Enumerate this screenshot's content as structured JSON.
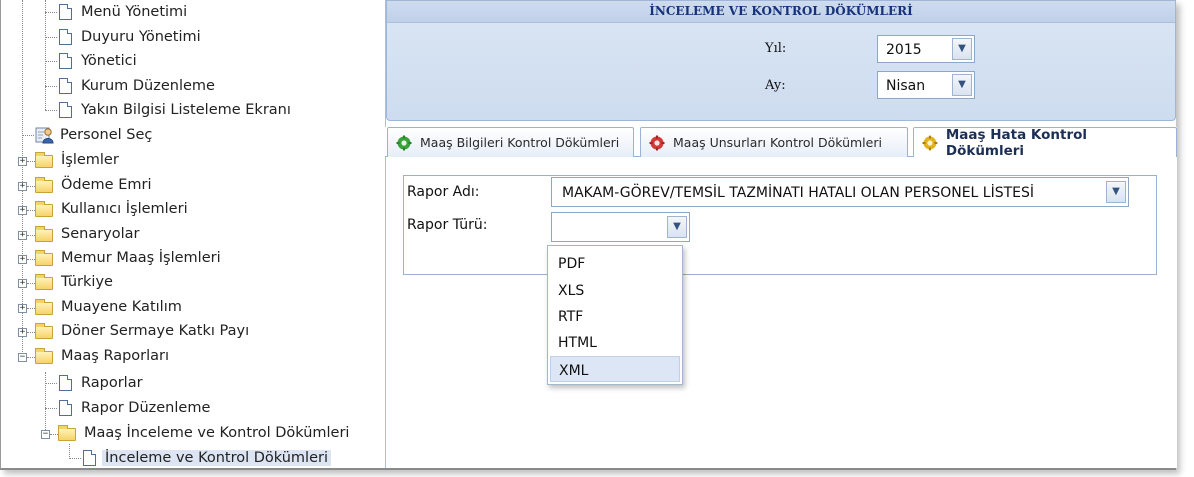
{
  "tree": {
    "items": [
      {
        "label": "Menü Yönetimi",
        "type": "doc"
      },
      {
        "label": "Duyuru Yönetimi",
        "type": "doc"
      },
      {
        "label": "Yönetici",
        "type": "doc"
      },
      {
        "label": "Kurum Düzenleme",
        "type": "doc"
      },
      {
        "label": "Yakın Bilgisi Listeleme Ekranı",
        "type": "doc"
      },
      {
        "label": "Personel Seç",
        "type": "user"
      },
      {
        "label": "İşlemler",
        "type": "folder"
      },
      {
        "label": "Ödeme Emri",
        "type": "folder"
      },
      {
        "label": "Kullanıcı İşlemleri",
        "type": "folder"
      },
      {
        "label": "Senaryolar",
        "type": "folder"
      },
      {
        "label": "Memur Maaş İşlemleri",
        "type": "folder"
      },
      {
        "label": "Türkiye",
        "type": "folder"
      },
      {
        "label": "Muayene Katılım",
        "type": "folder"
      },
      {
        "label": "Döner Sermaye Katkı Payı",
        "type": "folder"
      },
      {
        "label": "Maaş Raporları",
        "type": "folder-open"
      },
      {
        "label": "Raporlar",
        "type": "doc"
      },
      {
        "label": "Rapor Düzenleme",
        "type": "doc"
      },
      {
        "label": "Maaş İnceleme ve Kontrol Dökümleri",
        "type": "folder-open"
      },
      {
        "label": "İnceleme ve Kontrol Dökümleri",
        "type": "doc",
        "selected": true
      }
    ],
    "expand_plus": "+",
    "expand_minus": "−"
  },
  "filter": {
    "title": "İNCELEME VE KONTROL DÖKÜMLERİ",
    "year_label": "Yıl:",
    "year_value": "2015",
    "month_label": "Ay:",
    "month_value": "Nisan",
    "arrow_icon": "chevron-down-icon"
  },
  "tabs": [
    {
      "label": "Maaş Bilgileri Kontrol Dökümleri",
      "icon_color": "#3aa23a"
    },
    {
      "label": "Maaş Unsurları Kontrol Dökümleri",
      "icon_color": "#d23a3a"
    },
    {
      "label": "Maaş Hata Kontrol Dökümleri",
      "icon_color": "#e3b319",
      "active": true
    }
  ],
  "form": {
    "report_name_label": "Rapor Adı:",
    "report_name_value": "MAKAM-GÖREV/TEMSİL TAZMİNATI HATALI OLAN PERSONEL LİSTESİ",
    "report_type_label": "Rapor Türü:",
    "report_type_value": "",
    "report_type_options": [
      "PDF",
      "XLS",
      "RTF",
      "HTML",
      "XML"
    ],
    "highlighted_option": "XML"
  }
}
